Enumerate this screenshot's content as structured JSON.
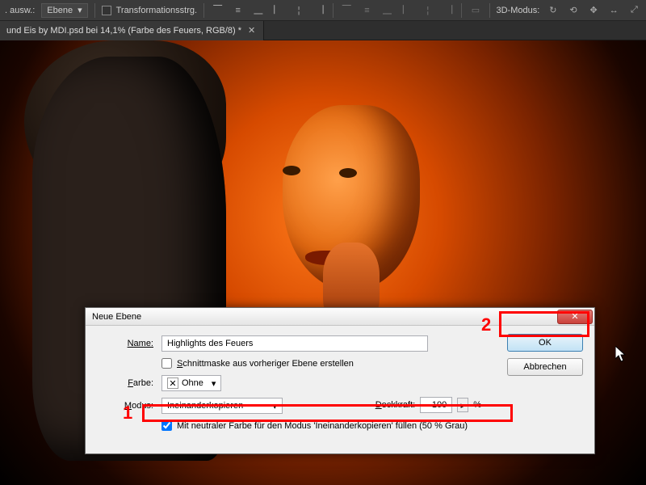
{
  "toolbar": {
    "ausw_label": ". ausw.:",
    "ausw_value": "Ebene",
    "transform_checkbox_label": "Transformationsstrg.",
    "mode3d_label": "3D-Modus:"
  },
  "document_tab": {
    "title": "und Eis by MDI.psd bei 14,1% (Farbe des Feuers, RGB/8) *"
  },
  "dialog": {
    "title": "Neue Ebene",
    "name_label": "Name:",
    "name_value": "Highlights des Feuers",
    "clip_checkbox_label": "Schnittmaske aus vorheriger Ebene erstellen",
    "clip_checked": false,
    "color_label": "Farbe:",
    "color_value": "Ohne",
    "color_swatch_glyph": "✕",
    "mode_label": "Modus:",
    "mode_value": "Ineinanderkopieren",
    "opacity_label": "Deckkraft:",
    "opacity_value": "100",
    "opacity_suffix": "%",
    "neutral_checkbox_label": "Mit neutraler Farbe für den Modus 'Ineinanderkopieren' füllen (50 % Grau)",
    "neutral_checked": true,
    "ok_label": "OK",
    "cancel_label": "Abbrechen"
  },
  "annotations": {
    "num1": "1",
    "num2": "2"
  },
  "icons": {
    "chevron_down": "▾",
    "close_x": "✕",
    "stepper_tri": "▸"
  }
}
